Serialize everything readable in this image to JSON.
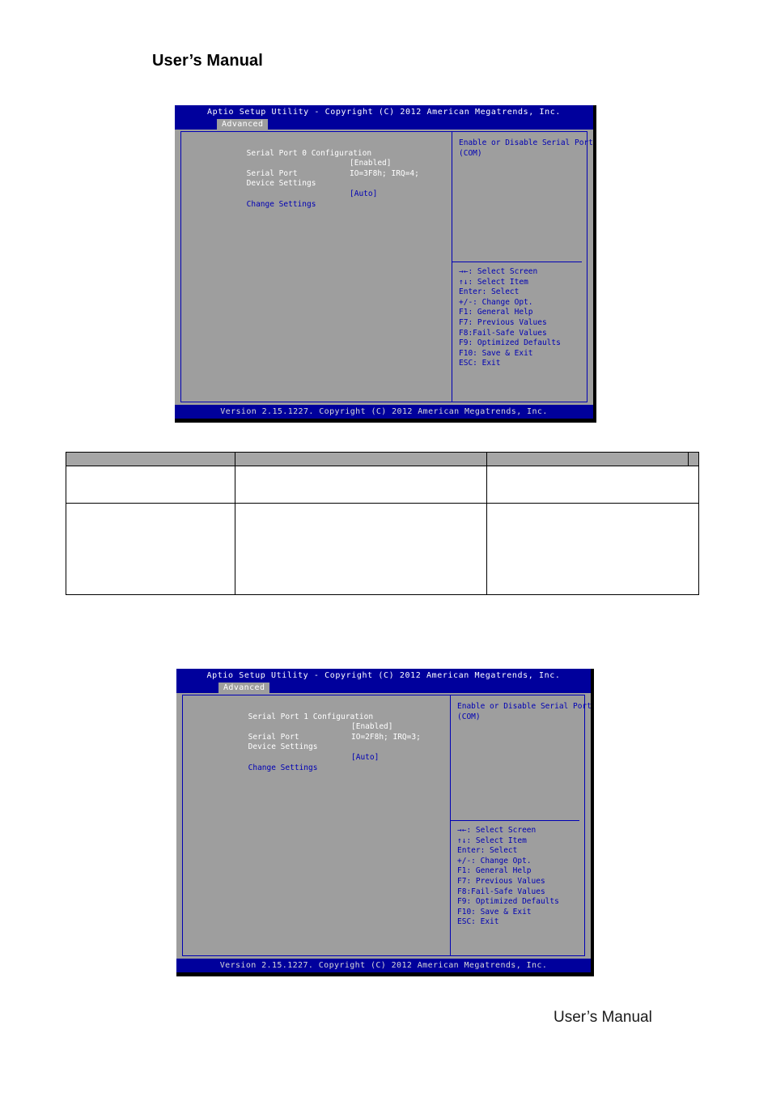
{
  "page": {
    "header_title": "User’s Manual",
    "footer_title": "User’s Manual"
  },
  "colors": {
    "bios_title_bar": "#00009c",
    "bios_body": "#9e9e9e",
    "bios_text_white": "#ffffff",
    "bios_text_blue": "#0000b4",
    "table_header": "#a6a6a6",
    "table_border": "#000000"
  },
  "bios_screens": [
    {
      "title": "Aptio Setup Utility - Copyright (C) 2012 American Megatrends, Inc.",
      "tab": "Advanced",
      "section_heading": "Serial Port 0 Configuration",
      "items": [
        {
          "label": "Serial Port",
          "value": "[Enabled]",
          "style": "white"
        },
        {
          "label": "Device Settings",
          "value": "IO=3F8h; IRQ=4;",
          "style": "white"
        },
        {
          "label": "Change Settings",
          "value": "[Auto]",
          "style": "blue"
        }
      ],
      "help": [
        "Enable or Disable Serial Port",
        "(COM)"
      ],
      "legend": [
        "→←: Select Screen",
        "↑↓: Select Item",
        "Enter: Select",
        "+/-: Change Opt.",
        "F1: General Help",
        "F7: Previous Values",
        "F8:Fail-Safe Values",
        "F9: Optimized Defaults",
        "F10: Save & Exit",
        "ESC: Exit"
      ],
      "status": "Version 2.15.1227. Copyright (C) 2012 American Megatrends, Inc."
    },
    {
      "title": "Aptio Setup Utility - Copyright (C) 2012 American Megatrends, Inc.",
      "tab": "Advanced",
      "section_heading": "Serial Port 1 Configuration",
      "items": [
        {
          "label": "Serial Port",
          "value": "[Enabled]",
          "style": "white"
        },
        {
          "label": "Device Settings",
          "value": "IO=2F8h; IRQ=3;",
          "style": "white"
        },
        {
          "label": "Change Settings",
          "value": "[Auto]",
          "style": "blue"
        }
      ],
      "help": [
        "Enable or Disable Serial Port",
        "(COM)"
      ],
      "legend": [
        "→←: Select Screen",
        "↑↓: Select Item",
        "Enter: Select",
        "+/-: Change Opt.",
        "F1: General Help",
        "F7: Previous Values",
        "F8:Fail-Safe Values",
        "F9: Optimized Defaults",
        "F10: Save & Exit",
        "ESC: Exit"
      ],
      "status": "Version 2.15.1227. Copyright (C) 2012 American Megatrends, Inc."
    }
  ],
  "data_table": {
    "headers": [
      "",
      "",
      "",
      ""
    ],
    "rows": [
      [
        "",
        "",
        ""
      ],
      [
        "",
        "",
        ""
      ]
    ]
  }
}
